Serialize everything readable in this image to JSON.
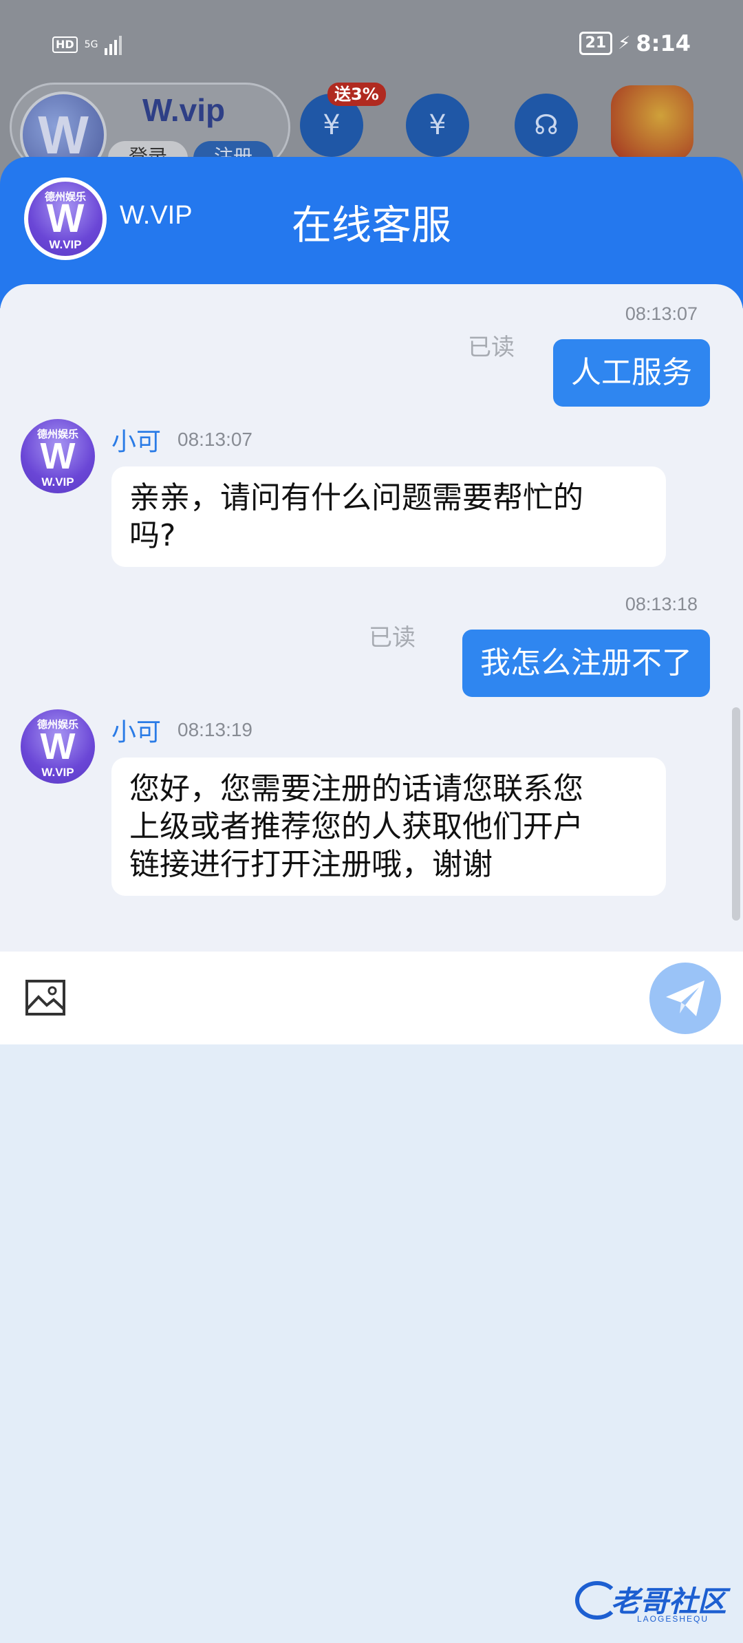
{
  "status_bar": {
    "hd": "HD",
    "network": "5G",
    "battery": "21",
    "time": "8:14"
  },
  "background_app": {
    "brand": "W.vip",
    "login_label": "登录",
    "register_label": "注册",
    "promo_badge": "送3%",
    "icons": [
      "deposit-icon",
      "withdraw-icon",
      "support-icon",
      "gift-icon"
    ]
  },
  "header": {
    "logo_top": "德州娱乐",
    "logo_letter": "W",
    "logo_bottom": "W.VIP",
    "name": "W.VIP",
    "title": "在线客服"
  },
  "messages": [
    {
      "from": "me",
      "time": "08:13:07",
      "status": "已读",
      "text": "人工服务"
    },
    {
      "from": "agent",
      "name": "小可",
      "time": "08:13:07",
      "lines": [
        "亲亲，请问有什么问题需要帮忙的",
        "吗?"
      ]
    },
    {
      "from": "me",
      "time": "08:13:18",
      "status": "已读",
      "text": "我怎么注册不了"
    },
    {
      "from": "agent",
      "name": "小可",
      "time": "08:13:19",
      "lines": [
        "您好，您需要注册的话请您联系您",
        "上级或者推荐您的人获取他们开户",
        "链接进行打开注册哦，谢谢"
      ]
    }
  ],
  "input": {
    "image_button": "image-icon",
    "send_button": "send-icon"
  },
  "watermark": {
    "text": "老哥社区",
    "sub": "LAOGESHEQU"
  },
  "colors": {
    "header_blue": "#2478ee",
    "my_bubble": "#2f86f0",
    "agent_name": "#2a7be6",
    "send_button": "#9ac3f7"
  }
}
